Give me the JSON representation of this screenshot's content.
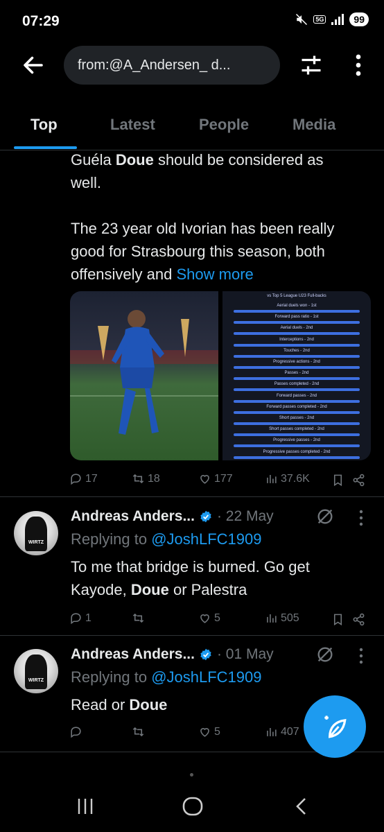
{
  "status_bar": {
    "time": "07:29",
    "network": "5G",
    "battery": "99"
  },
  "search": {
    "query": "from:@A_Andersen_ d..."
  },
  "tabs": [
    {
      "label": "Top",
      "active": true
    },
    {
      "label": "Latest",
      "active": false
    },
    {
      "label": "People",
      "active": false
    },
    {
      "label": "Media",
      "active": false
    }
  ],
  "tweet1": {
    "line1_pre": "Guéla ",
    "line1_bold": "Doue",
    "line1_post": " should be considered as",
    "line2": "well.",
    "para2_line1": "The 23 year old Ivorian has been really",
    "para2_line2": "good for Strasbourg this season, both",
    "para2_line3_pre": "offensively and ",
    "show_more": "Show more",
    "stats_title": "vs Top 5 League U23 Full-backs",
    "stats_rows": [
      "Aerial duels won - 1st",
      "Forward pass ratio - 1st",
      "Aerial duels - 2nd",
      "Interceptions - 2nd",
      "Touches - 2nd",
      "Progressive actions - 2nd",
      "Passes - 2nd",
      "Passes completed - 2nd",
      "Forward passes - 2nd",
      "Forward passes completed - 2nd",
      "Short passes - 2nd",
      "Short passes completed - 2nd",
      "Progressive passes - 2nd",
      "Progressive passes completed - 2nd"
    ],
    "replies": "17",
    "reposts": "18",
    "likes": "177",
    "views": "37.6K"
  },
  "tweet2": {
    "author": "Andreas Anders...",
    "date": "· 22 May",
    "replying_prefix": "Replying to ",
    "replying_to": "@JoshLFC1909",
    "line1": "To me that bridge is burned. Go get",
    "line2_pre": "Kayode, ",
    "line2_bold": "Doue",
    "line2_post": " or Palestra",
    "replies": "1",
    "likes": "5",
    "views": "505",
    "avatar_text": "WIRTZ"
  },
  "tweet3": {
    "author": "Andreas Anders...",
    "date": "· 01 May",
    "replying_prefix": "Replying to ",
    "replying_to": "@JoshLFC1909",
    "text_pre": "Read or ",
    "text_bold": "Doue",
    "likes": "5",
    "views": "407",
    "avatar_text": "WIRTZ"
  },
  "colors": {
    "accent": "#1d9bf0",
    "background": "#000000",
    "muted": "#71767b"
  }
}
